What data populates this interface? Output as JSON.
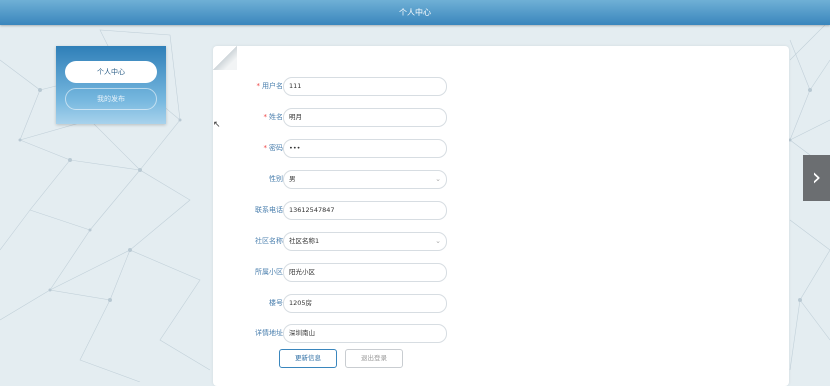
{
  "header": {
    "title": "个人中心"
  },
  "sidebar": {
    "items": [
      {
        "label": "个人中心",
        "active": true
      },
      {
        "label": "我的发布",
        "active": false
      }
    ]
  },
  "form": {
    "fields": [
      {
        "label": "用户名",
        "required": true,
        "value": "111",
        "type": "text"
      },
      {
        "label": "姓名",
        "required": true,
        "value": "明月",
        "type": "text"
      },
      {
        "label": "密码",
        "required": true,
        "value": "•••",
        "type": "password"
      },
      {
        "label": "性别",
        "required": false,
        "value": "男",
        "type": "select"
      },
      {
        "label": "联系电话",
        "required": false,
        "value": "13612547847",
        "type": "text"
      },
      {
        "label": "社区名称",
        "required": false,
        "value": "社区名称1",
        "type": "select"
      },
      {
        "label": "所属小区",
        "required": false,
        "value": "阳光小区",
        "type": "text"
      },
      {
        "label": "楼号",
        "required": false,
        "value": "1205房",
        "type": "text"
      },
      {
        "label": "详情地址",
        "required": false,
        "value": "深圳南山",
        "type": "text"
      }
    ],
    "required_mark": "*",
    "update_button": "更新信息",
    "logout_button": "退出登录"
  },
  "icons": {
    "select_chevron": "chevron-down-icon",
    "next": "chevron-right-icon"
  },
  "colors": {
    "header": "#3a86bd",
    "accent": "#4a7fae",
    "required": "#e44444"
  }
}
